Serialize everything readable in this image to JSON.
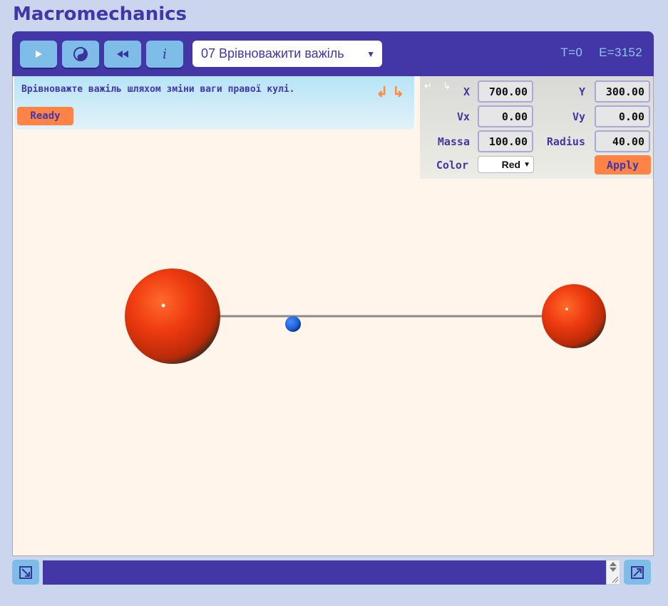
{
  "app": {
    "title": "Macromechanics"
  },
  "toolbar": {
    "buttons": [
      {
        "id": "play",
        "icon": "play-icon"
      },
      {
        "id": "yin-yang",
        "icon": "yin-yang-icon"
      },
      {
        "id": "rewind",
        "icon": "rewind-icon"
      },
      {
        "id": "info",
        "icon": "info-icon",
        "label": "i"
      }
    ],
    "level_select": {
      "value": "07 Врівноважити важіль"
    },
    "status": {
      "time": "T=0",
      "energy": "E=3152"
    }
  },
  "message": {
    "text": "Врівноважте важіль шляхом зміни ваги правої кулі.",
    "undo_icon": "undo-arrow-icon",
    "redo_icon": "redo-arrow-icon",
    "undo_glyph": "↲",
    "redo_glyph": "↳",
    "ready_label": "Ready"
  },
  "properties": {
    "mini_undo": "↵ ↳",
    "labels": {
      "x": "X",
      "y": "Y",
      "vx": "Vx",
      "vy": "Vy",
      "mass": "Massa",
      "radius": "Radius",
      "color": "Color"
    },
    "values": {
      "x": "700.00",
      "y": "300.00",
      "vx": "0.00",
      "vy": "0.00",
      "mass": "100.00",
      "radius": "40.00"
    },
    "color_value": "Red",
    "apply_label": "Apply"
  },
  "colors": {
    "brand": "#4336a6",
    "accent_orange": "#fd8347",
    "button_blue": "#7fbde9",
    "stage_bg": "#fff5ea",
    "ball_red": "#ee3a10",
    "pivot_blue": "#1a5fd6"
  }
}
